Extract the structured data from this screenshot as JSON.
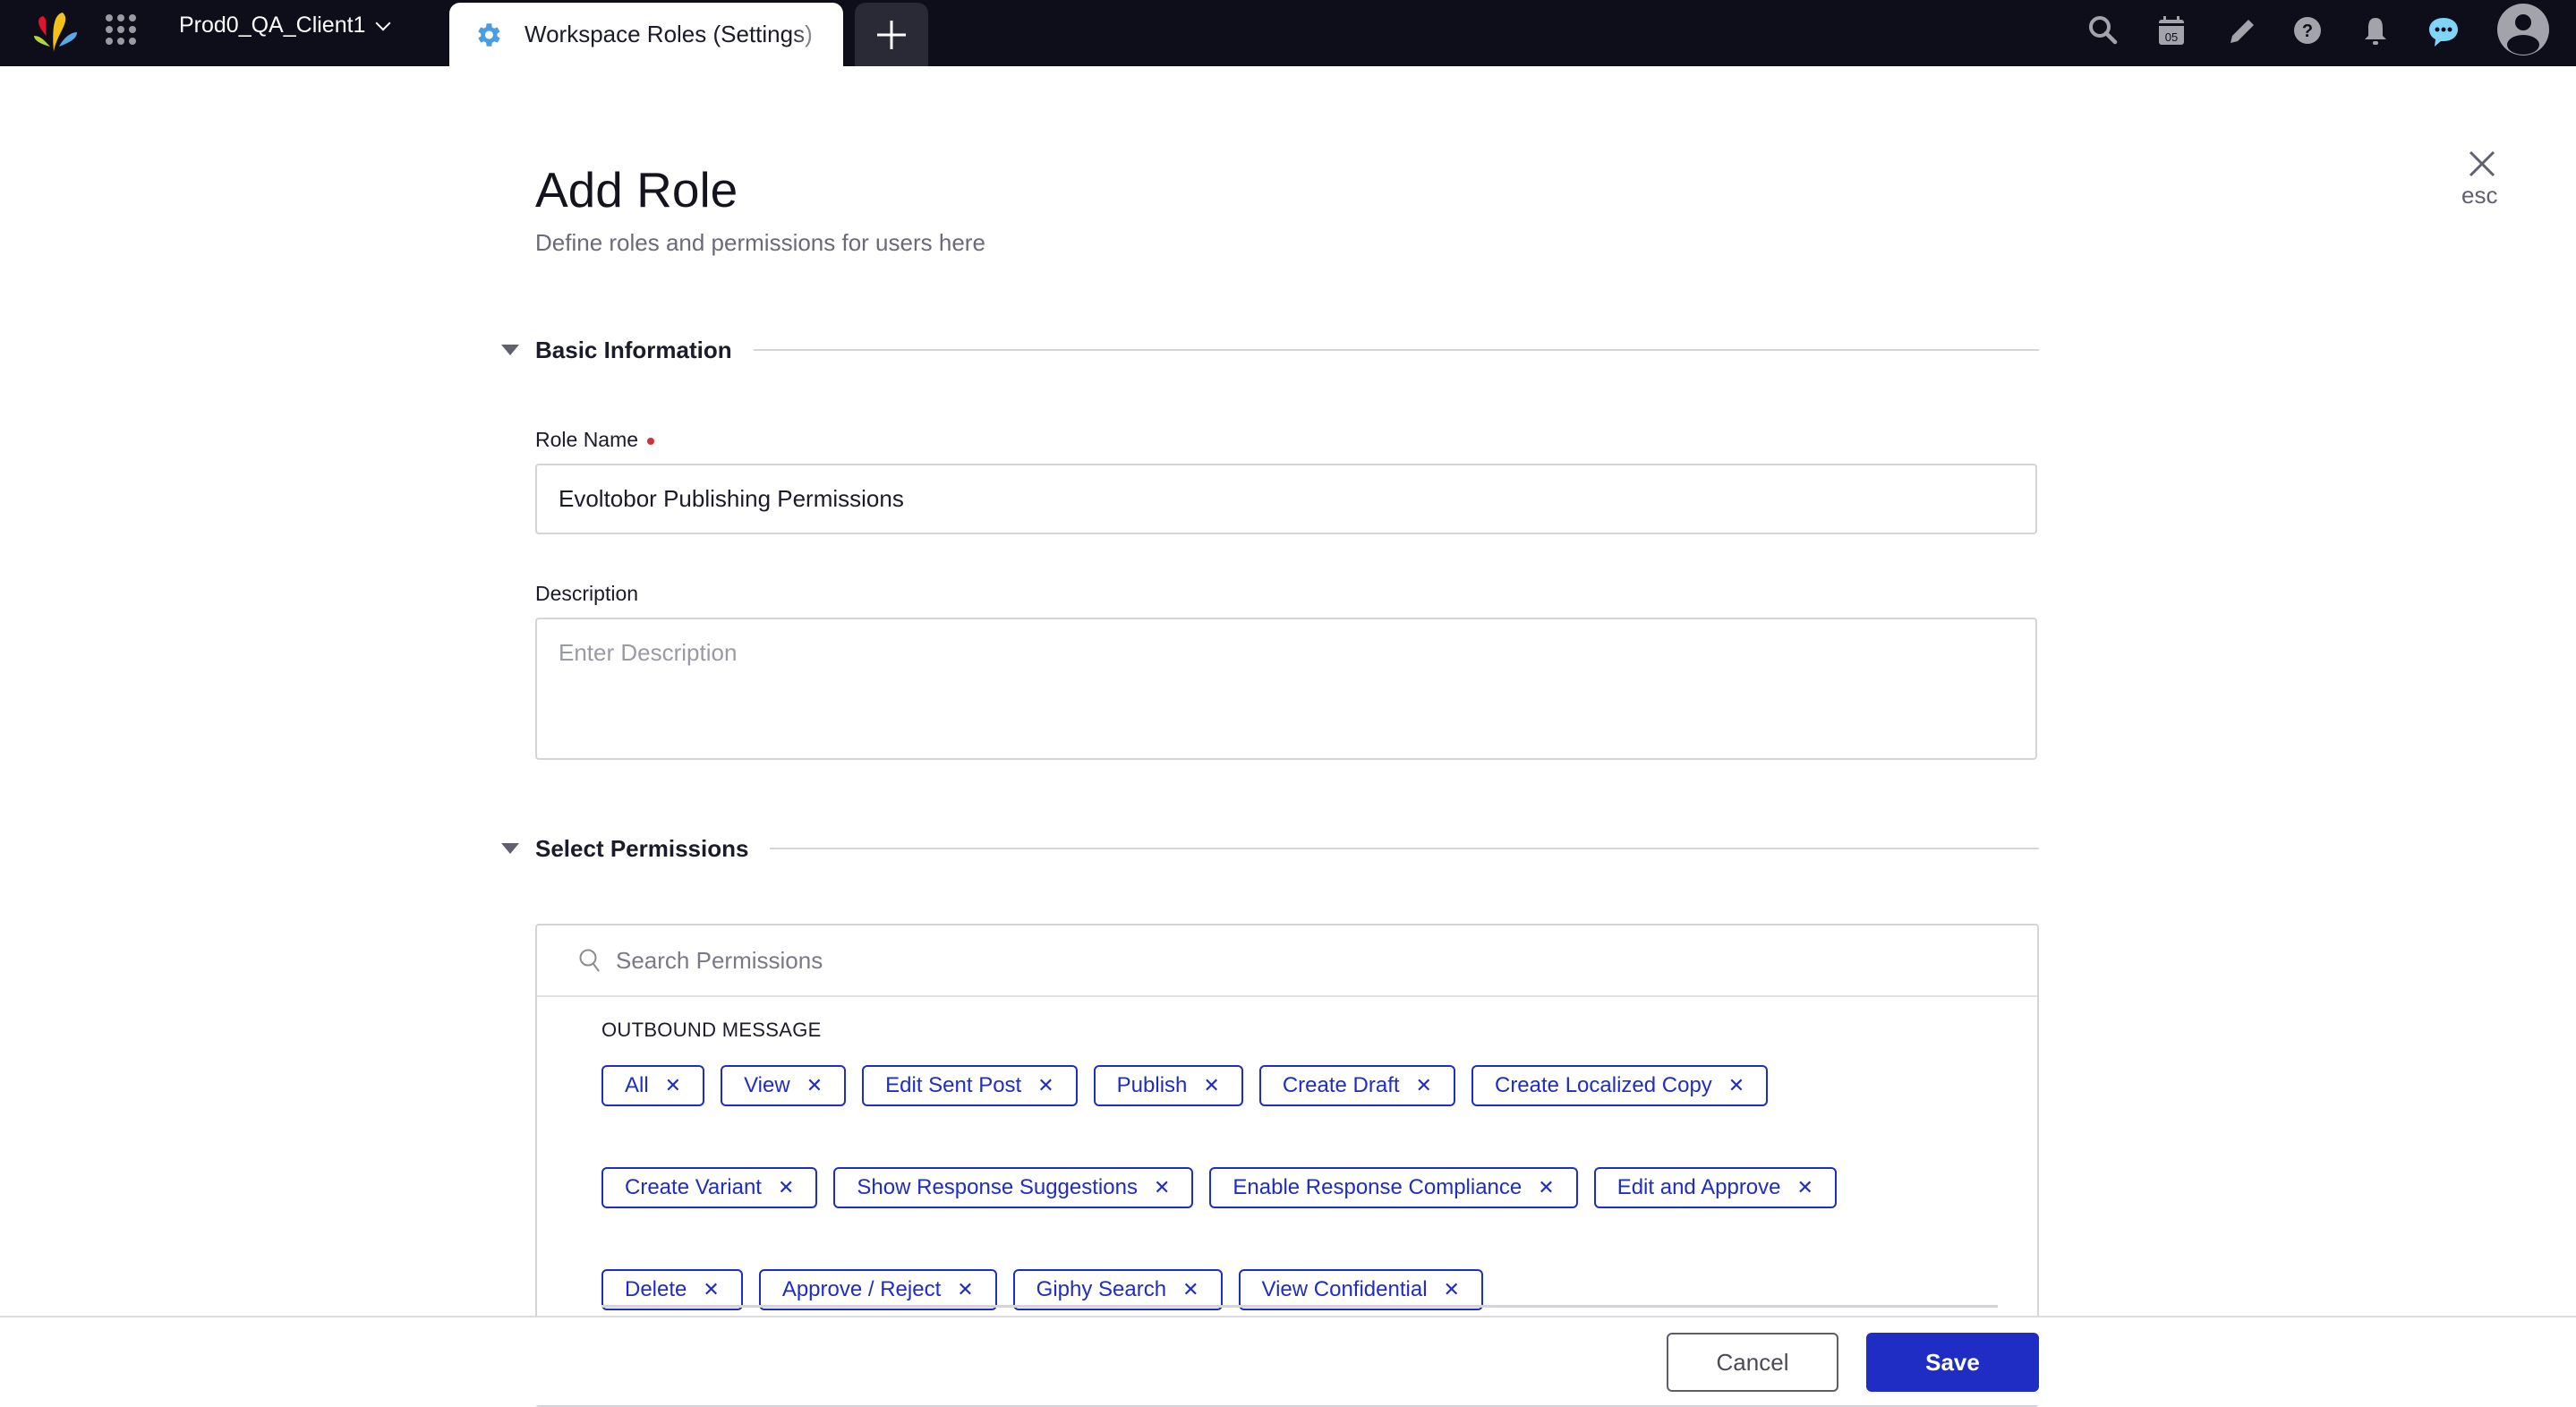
{
  "topbar": {
    "workspace_name": "Prod0_QA_Client1",
    "active_tab_label": "Workspace Roles (Settings)",
    "calendar_day": "05",
    "icons": [
      "search-icon",
      "calendar-icon",
      "pencil-icon",
      "help-icon",
      "bell-icon",
      "chat-icon",
      "avatar-icon"
    ],
    "colors": {
      "background": "#0e0e1a",
      "chat_accent": "#7fd4f7",
      "gear_accent": "#4a9de0"
    }
  },
  "dialog": {
    "title": "Add Role",
    "subtitle": "Define roles and permissions for users here",
    "close_label": "esc"
  },
  "basic_info": {
    "section_title": "Basic Information",
    "role_name_label": "Role Name",
    "role_name_value": "Evoltobor Publishing Permissions",
    "description_label": "Description",
    "description_placeholder": "Enter Description",
    "description_value": ""
  },
  "permissions": {
    "section_title": "Select Permissions",
    "search_placeholder": "Search Permissions",
    "groups": [
      {
        "title": "OUTBOUND MESSAGE",
        "tags": [
          "All",
          "View",
          "Edit Sent Post",
          "Publish",
          "Create Draft",
          "Create Localized Copy",
          "Create Variant",
          "Show Response Suggestions",
          "Enable Response Compliance",
          "Edit and Approve",
          "Delete",
          "Approve / Reject",
          "Giphy Search",
          "View Confidential"
        ]
      }
    ],
    "tag_color": "#1f2dc4",
    "remove_glyph": "✕"
  },
  "footer": {
    "cancel_label": "Cancel",
    "save_label": "Save",
    "save_color": "#1f2dc4"
  }
}
